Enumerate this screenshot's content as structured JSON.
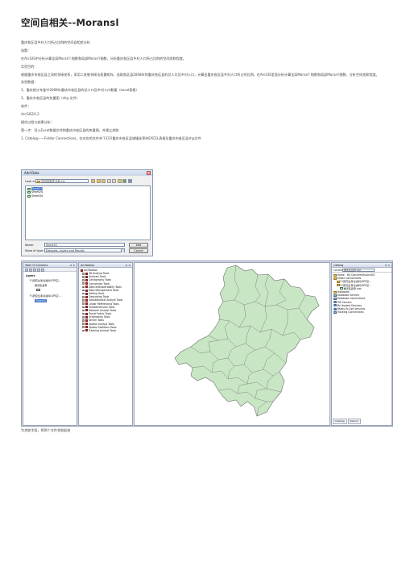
{
  "title": "空间自相关--Moransl",
  "paragraphs": [
    "重庆各区县乡村人口所占比例的空间自相关分析",
    "选题：",
    "在ArcGIS中分析计算全局Moran'I 指数和局部Moran'I指数，分析重庆各区县乡村人口所占比例的空间关联程度。",
    "实验目的：",
    "根据重庆市各区县之间的邻接关系，采用二进制邻接法权重矩阵，选取各区县2008年的重庆各区县的总人口及乡村人口，计算出重庆各区县乡村人口所占的比例，在ArcGIS里面分析计算全局Moran'I 指数和局部Moran'I指数，分析空间关联程度。",
    "实验数据：",
    "1、重庆统计年鉴中2008年重庆市各区县的总人口及乡村人口数量（excel表格）",
    "2、重庆市各区县的矢量图（shp.文件）",
    "软件：",
    "ArcGIS10.2",
    "操作过程与结果分析：",
    "第一步：导入Excel数据文件和重庆市各区县的矢量图，并建立关联",
    "1. Catalog——Folder Connections，在对应的文件夹下打开重庆市各区县城镇化率的EXCEL表格及重庆市各区县shp文件"
  ],
  "footer_text": "为关联字段，将两个文件关联起来",
  "add_data": {
    "title": "Add Data",
    "look_in_label": "Look in:",
    "look_in_value": "空间自相关分析.xls",
    "items": [
      {
        "label": "Sheet1$",
        "selected": true
      },
      {
        "label": "Sheet2$",
        "selected": false
      },
      {
        "label": "Sheet3$",
        "selected": false
      }
    ],
    "name_label": "Name:",
    "name_value": "Sheet1$",
    "type_label": "Show of type:",
    "type_value": "Datasets, Layers and Results",
    "add_button": "Add",
    "cancel_button": "Cancel"
  },
  "toc": {
    "title": "Table Of Contents",
    "items": [
      {
        "label": "Layers",
        "bold": true
      },
      {
        "label": "F:\\研究生考试资料\\GPS空..."
      },
      {
        "label": "重庆区县界"
      },
      {
        "label": "F:\\研究生考试资料\\GPS空..."
      },
      {
        "label": "Sheet1$",
        "selected": true
      }
    ]
  },
  "arctoolbox": {
    "title": "ArcToolbox",
    "root": "ArcToolbox",
    "tools": [
      "3D Analyst Tools",
      "Analysis Tools",
      "Cartography Tools",
      "Conversion Tools",
      "Data Interoperability Tools",
      "Data Management Tools",
      "Editing Tools",
      "Geocoding Tools",
      "Geostatistical Analyst Tools",
      "Linear Referencing Tools",
      "Multidimension Tools",
      "Network Analyst Tools",
      "Parcel Fabric Tools",
      "Schematics Tools",
      "Server Tools",
      "Spatial Analyst Tools",
      "Spatial Statistics Tools",
      "Tracking Analyst Tools"
    ]
  },
  "catalog": {
    "title": "Catalog",
    "location_label": "Location:",
    "location_value": "重庆区县界.shp",
    "items": [
      {
        "label": "Home - My Documents\\ArcGIS",
        "icon": "folder"
      },
      {
        "label": "Folder Connections",
        "icon": "folder"
      },
      {
        "label": "F:\\研究生考试资料\\GPS空...",
        "icon": "folder"
      },
      {
        "label": "F:\\研究生考试资料\\GPS空...",
        "icon": "folder"
      },
      {
        "label": "重庆区县界.shp",
        "icon": "shape"
      },
      {
        "label": "Toolboxes",
        "icon": "folder"
      },
      {
        "label": "Database Servers",
        "icon": "db"
      },
      {
        "label": "Database Connections",
        "icon": "db"
      },
      {
        "label": "GIS Servers",
        "icon": "globe"
      },
      {
        "label": "My Hosted Services",
        "icon": "globe"
      },
      {
        "label": "Ready-To-Use Services",
        "icon": "globe"
      },
      {
        "label": "Tracking Connections",
        "icon": "db"
      }
    ],
    "tabs": [
      "Catalog",
      "Search"
    ]
  },
  "colors": {
    "map_fill": "#c8e6c4",
    "map_stroke": "#6d6d6d",
    "selection": "#3a6fc4"
  }
}
